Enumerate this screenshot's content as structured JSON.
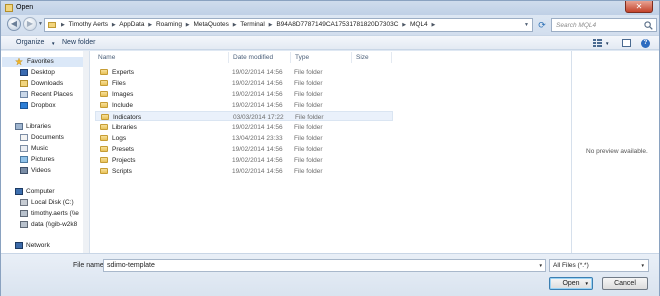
{
  "window": {
    "title": "Open",
    "close_glyph": "✕"
  },
  "address_bar": {
    "crumbs": [
      "Timothy Aerts",
      "AppData",
      "Roaming",
      "MetaQuotes",
      "Terminal",
      "B94A8D7787149CA17531781820D7303C",
      "MQL4"
    ],
    "search_placeholder": "Search MQL4"
  },
  "toolbar": {
    "organize_label": "Organize",
    "new_folder_label": "New folder"
  },
  "nav": {
    "items": [
      {
        "label": "Favorites",
        "icon": "star-icon"
      },
      {
        "label": "Desktop",
        "icon": "desktop-icon"
      },
      {
        "label": "Downloads",
        "icon": "downloads-icon"
      },
      {
        "label": "Recent Places",
        "icon": "recent-places-icon"
      },
      {
        "label": "Dropbox",
        "icon": "dropbox-icon"
      },
      {
        "label": "Libraries",
        "icon": "libraries-icon"
      },
      {
        "label": "Documents",
        "icon": "documents-icon"
      },
      {
        "label": "Music",
        "icon": "music-icon"
      },
      {
        "label": "Pictures",
        "icon": "pictures-icon"
      },
      {
        "label": "Videos",
        "icon": "videos-icon"
      },
      {
        "label": "Computer",
        "icon": "computer-icon"
      },
      {
        "label": "Local Disk (C:)",
        "icon": "local-disk-icon"
      },
      {
        "label": "timothy.aerts (\\\\e",
        "icon": "network-drive-icon"
      },
      {
        "label": "data (\\\\gib-w2k8",
        "icon": "network-drive-icon"
      },
      {
        "label": "Network",
        "icon": "network-icon"
      }
    ]
  },
  "columns": {
    "name": "Name",
    "date": "Date modified",
    "type": "Type",
    "size": "Size"
  },
  "files": [
    {
      "name": "Experts",
      "date": "19/02/2014 14:56",
      "type": "File folder"
    },
    {
      "name": "Files",
      "date": "19/02/2014 14:56",
      "type": "File folder"
    },
    {
      "name": "Images",
      "date": "19/02/2014 14:56",
      "type": "File folder"
    },
    {
      "name": "Include",
      "date": "19/02/2014 14:56",
      "type": "File folder"
    },
    {
      "name": "Indicators",
      "date": "03/03/2014 17:22",
      "type": "File folder"
    },
    {
      "name": "Libraries",
      "date": "19/02/2014 14:56",
      "type": "File folder"
    },
    {
      "name": "Logs",
      "date": "13/04/2014 23:33",
      "type": "File folder"
    },
    {
      "name": "Presets",
      "date": "19/02/2014 14:56",
      "type": "File folder"
    },
    {
      "name": "Projects",
      "date": "19/02/2014 14:56",
      "type": "File folder"
    },
    {
      "name": "Scripts",
      "date": "19/02/2014 14:56",
      "type": "File folder"
    }
  ],
  "selected_file": "Indicators",
  "preview": {
    "text": "No preview available."
  },
  "footer": {
    "file_name_label": "File name:",
    "file_name_value": "sdimo-template",
    "file_type_value": "All Files (*.*)",
    "open_label": "Open",
    "cancel_label": "Cancel"
  },
  "colors": {
    "accent": "#2d70b5",
    "selection": "#eaf1fb",
    "folder": "#e8c25a"
  }
}
